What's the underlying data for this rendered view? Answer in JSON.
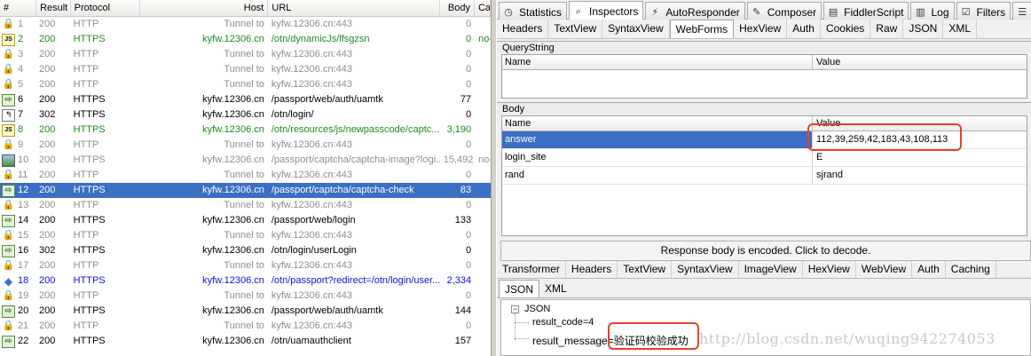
{
  "sessions": {
    "columns": {
      "num": "#",
      "result": "Result",
      "protocol": "Protocol",
      "host": "Host",
      "url": "URL",
      "body": "Body",
      "caching": "Ca"
    },
    "rows": [
      {
        "id": "1",
        "icon": "lock",
        "result": "200",
        "protocol": "HTTP",
        "host": "Tunnel to",
        "url": "kyfw.12306.cn:443",
        "body": "0",
        "caching": "",
        "color": "gray"
      },
      {
        "id": "2",
        "icon": "js",
        "result": "200",
        "protocol": "HTTPS",
        "host": "kyfw.12306.cn",
        "url": "/otn/dynamicJs/lfsgzsn",
        "body": "0",
        "caching": "no-",
        "color": "green"
      },
      {
        "id": "3",
        "icon": "lock",
        "result": "200",
        "protocol": "HTTP",
        "host": "Tunnel to",
        "url": "kyfw.12306.cn:443",
        "body": "0",
        "caching": "",
        "color": "gray"
      },
      {
        "id": "4",
        "icon": "lock",
        "result": "200",
        "protocol": "HTTP",
        "host": "Tunnel to",
        "url": "kyfw.12306.cn:443",
        "body": "0",
        "caching": "",
        "color": "gray"
      },
      {
        "id": "5",
        "icon": "lock",
        "result": "200",
        "protocol": "HTTP",
        "host": "Tunnel to",
        "url": "kyfw.12306.cn:443",
        "body": "0",
        "caching": "",
        "color": "gray"
      },
      {
        "id": "6",
        "icon": "arrow",
        "result": "200",
        "protocol": "HTTPS",
        "host": "kyfw.12306.cn",
        "url": "/passport/web/auth/uamtk",
        "body": "77",
        "caching": "",
        "color": "black"
      },
      {
        "id": "7",
        "icon": "redirect",
        "result": "302",
        "protocol": "HTTPS",
        "host": "kyfw.12306.cn",
        "url": "/otn/login/",
        "body": "0",
        "caching": "",
        "color": "black"
      },
      {
        "id": "8",
        "icon": "js",
        "result": "200",
        "protocol": "HTTPS",
        "host": "kyfw.12306.cn",
        "url": "/otn/resources/js/newpasscode/captc...",
        "body": "3,190",
        "caching": "",
        "color": "green"
      },
      {
        "id": "9",
        "icon": "lock",
        "result": "200",
        "protocol": "HTTP",
        "host": "Tunnel to",
        "url": "kyfw.12306.cn:443",
        "body": "0",
        "caching": "",
        "color": "gray"
      },
      {
        "id": "10",
        "icon": "image",
        "result": "200",
        "protocol": "HTTPS",
        "host": "kyfw.12306.cn",
        "url": "/passport/captcha/captcha-image?logi...",
        "body": "15,492",
        "caching": "no-",
        "color": "gray"
      },
      {
        "id": "11",
        "icon": "lock",
        "result": "200",
        "protocol": "HTTP",
        "host": "Tunnel to",
        "url": "kyfw.12306.cn:443",
        "body": "0",
        "caching": "",
        "color": "gray"
      },
      {
        "id": "12",
        "icon": "arrow",
        "result": "200",
        "protocol": "HTTPS",
        "host": "kyfw.12306.cn",
        "url": "/passport/captcha/captcha-check",
        "body": "83",
        "caching": "",
        "color": "black",
        "selected": true
      },
      {
        "id": "13",
        "icon": "lock",
        "result": "200",
        "protocol": "HTTP",
        "host": "Tunnel to",
        "url": "kyfw.12306.cn:443",
        "body": "0",
        "caching": "",
        "color": "gray"
      },
      {
        "id": "14",
        "icon": "arrow",
        "result": "200",
        "protocol": "HTTPS",
        "host": "kyfw.12306.cn",
        "url": "/passport/web/login",
        "body": "133",
        "caching": "",
        "color": "black"
      },
      {
        "id": "15",
        "icon": "lock",
        "result": "200",
        "protocol": "HTTP",
        "host": "Tunnel to",
        "url": "kyfw.12306.cn:443",
        "body": "0",
        "caching": "",
        "color": "gray"
      },
      {
        "id": "16",
        "icon": "arrow",
        "result": "302",
        "protocol": "HTTPS",
        "host": "kyfw.12306.cn",
        "url": "/otn/login/userLogin",
        "body": "0",
        "caching": "",
        "color": "black"
      },
      {
        "id": "17",
        "icon": "lock",
        "result": "200",
        "protocol": "HTTP",
        "host": "Tunnel to",
        "url": "kyfw.12306.cn:443",
        "body": "0",
        "caching": "",
        "color": "gray"
      },
      {
        "id": "18",
        "icon": "diamond",
        "result": "200",
        "protocol": "HTTPS",
        "host": "kyfw.12306.cn",
        "url": "/otn/passport?redirect=/otn/login/user...",
        "body": "2,334",
        "caching": "",
        "color": "blue"
      },
      {
        "id": "19",
        "icon": "lock",
        "result": "200",
        "protocol": "HTTP",
        "host": "Tunnel to",
        "url": "kyfw.12306.cn:443",
        "body": "0",
        "caching": "",
        "color": "gray"
      },
      {
        "id": "20",
        "icon": "arrow",
        "result": "200",
        "protocol": "HTTPS",
        "host": "kyfw.12306.cn",
        "url": "/passport/web/auth/uamtk",
        "body": "144",
        "caching": "",
        "color": "black"
      },
      {
        "id": "21",
        "icon": "lock",
        "result": "200",
        "protocol": "HTTP",
        "host": "Tunnel to",
        "url": "kyfw.12306.cn:443",
        "body": "0",
        "caching": "",
        "color": "gray"
      },
      {
        "id": "22",
        "icon": "arrow",
        "result": "200",
        "protocol": "HTTPS",
        "host": "kyfw.12306.cn",
        "url": "/otn/uamauthclient",
        "body": "157",
        "caching": "",
        "color": "black"
      }
    ]
  },
  "main_tabs": [
    {
      "label": "Statistics",
      "icon": "stopwatch-icon"
    },
    {
      "label": "Inspectors",
      "icon": "inspect-icon",
      "active": true
    },
    {
      "label": "AutoResponder",
      "icon": "lightning-icon"
    },
    {
      "label": "Composer",
      "icon": "composer-icon"
    },
    {
      "label": "FiddlerScript",
      "icon": "script-icon"
    },
    {
      "label": "Log",
      "icon": "log-icon"
    },
    {
      "label": "Filters",
      "icon": "checkbox-icon"
    },
    {
      "label": "Tim",
      "icon": "timeline-icon"
    }
  ],
  "request_tabs": [
    "Headers",
    "TextView",
    "SyntaxView",
    "WebForms",
    "HexView",
    "Auth",
    "Cookies",
    "Raw",
    "JSON",
    "XML"
  ],
  "request_active_tab": "WebForms",
  "querystring": {
    "section": "QueryString",
    "name_col": "Name",
    "value_col": "Value"
  },
  "body": {
    "section": "Body",
    "name_col": "Name",
    "value_col": "Value",
    "rows": [
      {
        "name": "answer",
        "value": "112,39,259,42,183,43,108,113"
      },
      {
        "name": "login_site",
        "value": "E"
      },
      {
        "name": "rand",
        "value": "sjrand"
      }
    ]
  },
  "response": {
    "encoded_notice": "Response body is encoded. Click to decode.",
    "tabs": [
      "Transformer",
      "Headers",
      "TextView",
      "SyntaxView",
      "ImageView",
      "HexView",
      "WebView",
      "Auth",
      "Caching"
    ],
    "subtabs": [
      "JSON",
      "XML"
    ],
    "tree_root": "JSON",
    "tree_items": [
      "result_code=4",
      "result_message=验证码校验成功"
    ]
  },
  "watermark": "http://blog.csdn.net/wuqing942274053",
  "colors": {
    "selection": "#3a6fc4",
    "highlight_box": "#e8402a",
    "green_text": "#1e8a1e",
    "blue_text": "#1010d8",
    "gray_text": "#8e8e8e"
  }
}
